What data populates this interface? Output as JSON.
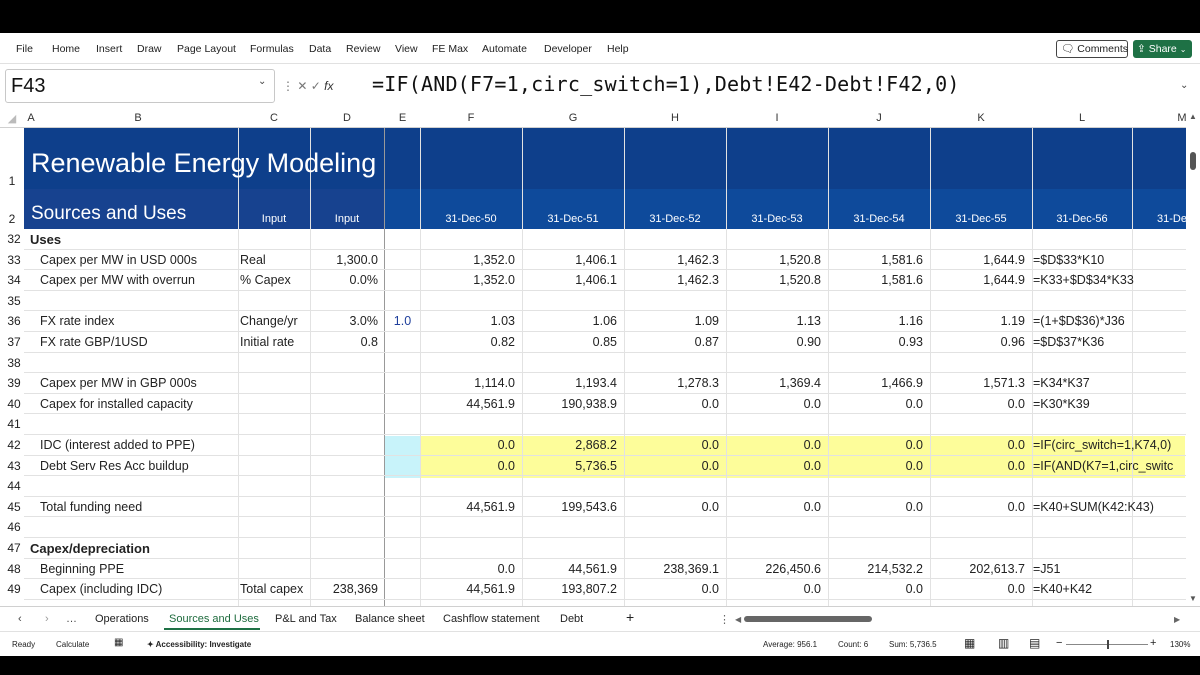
{
  "ribbon": {
    "menu": [
      "File",
      "Home",
      "Insert",
      "Draw",
      "Page Layout",
      "Formulas",
      "Data",
      "Review",
      "View",
      "FE Max",
      "Automate",
      "Developer",
      "Help"
    ],
    "comments_label": "Comments",
    "share_label": "Share"
  },
  "formula_bar": {
    "name_box": "F43",
    "fx": "fx",
    "formula": "=IF(AND(F7=1,circ_switch=1),Debt!E42-Debt!F42,0)"
  },
  "columns": [
    "A",
    "B",
    "C",
    "D",
    "E",
    "F",
    "G",
    "H",
    "I",
    "J",
    "K",
    "L",
    "M"
  ],
  "sheet": {
    "title": "Renewable Energy Modeling",
    "subtitle": "Sources and Uses",
    "input_hdr_c": "Input",
    "input_hdr_d": "Input",
    "dates": [
      "31-Dec-50",
      "31-Dec-51",
      "31-Dec-52",
      "31-Dec-53",
      "31-Dec-54",
      "31-Dec-55",
      "31-Dec-56",
      "31-De"
    ],
    "rows": [
      {
        "num": "32",
        "label": "Uses",
        "bold": true
      },
      {
        "num": "33",
        "label": "Capex per MW  in USD 000s",
        "c": "Real",
        "d": "1,300.0",
        "vals": [
          "1,352.0",
          "1,406.1",
          "1,462.3",
          "1,520.8",
          "1,581.6",
          "1,644.9"
        ],
        "formula": "=$D$33*K10"
      },
      {
        "num": "34",
        "label": "Capex per MW with overrun",
        "c": "% Capex",
        "d": "0.0%",
        "vals": [
          "1,352.0",
          "1,406.1",
          "1,462.3",
          "1,520.8",
          "1,581.6",
          "1,644.9"
        ],
        "formula": "=K33+$D$34*K33"
      },
      {
        "num": "35"
      },
      {
        "num": "36",
        "label": "FX rate index",
        "c": "Change/yr",
        "d": "3.0%",
        "e": "1.0",
        "vals": [
          "1.03",
          "1.06",
          "1.09",
          "1.13",
          "1.16",
          "1.19"
        ],
        "formula": "=(1+$D$36)*J36"
      },
      {
        "num": "37",
        "label": "FX rate GBP/1USD",
        "c": "Initial rate",
        "d": "0.8",
        "vals": [
          "0.82",
          "0.85",
          "0.87",
          "0.90",
          "0.93",
          "0.96"
        ],
        "formula": "=$D$37*K36"
      },
      {
        "num": "38"
      },
      {
        "num": "39",
        "label": "Capex per MW in GBP 000s",
        "vals": [
          "1,114.0",
          "1,193.4",
          "1,278.3",
          "1,369.4",
          "1,466.9",
          "1,571.3"
        ],
        "formula": "=K34*K37"
      },
      {
        "num": "40",
        "label": "Capex for installed capacity",
        "vals": [
          "44,561.9",
          "190,938.9",
          "0.0",
          "0.0",
          "0.0",
          "0.0"
        ],
        "formula": "=K30*K39"
      },
      {
        "num": "41"
      },
      {
        "num": "42",
        "label": "IDC (interest added to PPE)",
        "vals": [
          "0.0",
          "2,868.2",
          "0.0",
          "0.0",
          "0.0",
          "0.0"
        ],
        "formula": "=IF(circ_switch=1,K74,0)"
      },
      {
        "num": "43",
        "label": "Debt Serv Res Acc buildup",
        "vals": [
          "0.0",
          "5,736.5",
          "0.0",
          "0.0",
          "0.0",
          "0.0"
        ],
        "formula": "=IF(AND(K7=1,circ_switc"
      },
      {
        "num": "44"
      },
      {
        "num": "45",
        "label": "Total funding need",
        "vals": [
          "44,561.9",
          "199,543.6",
          "0.0",
          "0.0",
          "0.0",
          "0.0"
        ],
        "formula": "=K40+SUM(K42:K43)"
      },
      {
        "num": "46"
      },
      {
        "num": "47",
        "label": "Capex/depreciation",
        "bold": true
      },
      {
        "num": "48",
        "label": "Beginning PPE",
        "vals": [
          "0.0",
          "44,561.9",
          "238,369.1",
          "226,450.6",
          "214,532.2",
          "202,613.7"
        ],
        "formula": "=J51"
      },
      {
        "num": "49",
        "label": "Capex (including IDC)",
        "c": "Total capex",
        "d": "238,369",
        "vals": [
          "44,561.9",
          "193,807.2",
          "0.0",
          "0.0",
          "0.0",
          "0.0"
        ],
        "formula": "=K40+K42"
      }
    ]
  },
  "tabs": [
    "Operations",
    "Sources and Uses",
    "P&L and Tax",
    "Balance sheet",
    "Cashflow statement",
    "Debt"
  ],
  "active_tab": "Sources and Uses",
  "status": {
    "ready": "Ready",
    "calculate": "Calculate",
    "accessibility": "Accessibility: Investigate",
    "average": "Average: 956.1",
    "count": "Count: 6",
    "sum": "Sum: 5,736.5",
    "zoom": "130%"
  }
}
